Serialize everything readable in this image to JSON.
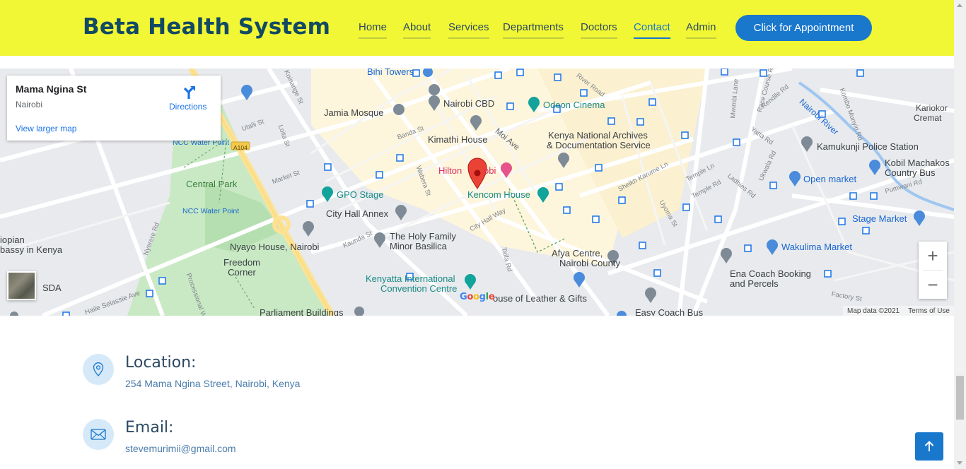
{
  "header": {
    "logo": "Beta Health System",
    "nav": [
      "Home",
      "About",
      "Services",
      "Departments",
      "Doctors",
      "Contact",
      "Admin"
    ],
    "active_nav": "Contact",
    "cta_label": "Click for Appointment"
  },
  "map": {
    "card": {
      "title": "Mama Ngina St",
      "subtitle": "Nairobi",
      "larger_map_link": "View larger map",
      "directions_label": "Directions"
    },
    "places": {
      "bihi_towers": "Bihi Towers",
      "nairobi_cbd": "Nairobi CBD",
      "odeon_cinema": "Odeon Cinema",
      "jamia_mosque": "Jamia Mosque",
      "kimathi_house": "Kimathi House",
      "kenya_archives_1": "Kenya National Archives",
      "kenya_archives_2": "& Documentation Service",
      "hilton_1": "Hilton",
      "hilton_2": "obi",
      "kencom_house": "Kencom House",
      "gpo_stage": "GPO Stage",
      "city_hall_annex": "City Hall Annex",
      "central_park": "Central Park",
      "ncc_water_point": "NCC Water Point",
      "holy_family_1": "The Holy Family",
      "holy_family_2": "Minor Basilica",
      "nyayo_house": "Nyayo House, Nairobi",
      "freedom_corner": "Freedom Corner",
      "kicc_1": "Kenyatta International",
      "kicc_2": "Convention Centre",
      "house_of_leather": "ouse of Leather & Gifts",
      "afya_centre_1": "Afya Centre,",
      "afya_centre_2": "Nairobi County",
      "ena_coach_1": "Ena Coach Booking",
      "ena_coach_2": "and Percels",
      "easy_coach": "Easy Coach Bus",
      "wakulima_market": "Wakulima Market",
      "stage_market": "Stage Market",
      "open_market": "Open market",
      "kamukunji_police": "Kamukunji Police Station",
      "kobil_1": "Kobil Machakos",
      "kobil_2": "Country Bus",
      "kariokor_1": "Kariokor",
      "kariokor_2": "Cremat",
      "nairobi_river": "Nairobi River",
      "parliament": "Parliament Buildings",
      "ethiopian_1": "iopian",
      "ethiopian_2": "bassy in Kenya",
      "sda": "SDA",
      "moi_ave": "Moi Ave",
      "a104": "A104",
      "processional_way": "Processional Way",
      "haile_selassie": "Haile Selassie Ave"
    },
    "streets": [
      "Utalii St",
      "Banda St",
      "Market St",
      "Wabera St",
      "Kaunda St",
      "City Hall Way",
      "Taifa Rd",
      "River Road",
      "Temple Ln",
      "Temple Rd",
      "Sheikh Karume Ln",
      "Uyoma St",
      "Ladhies Rd",
      "Ukwala Rd",
      "Yatta Rd",
      "Rendile Rd",
      "Nyerere Rd",
      "Koinange St",
      "Loita St",
      "Pumwani Rd",
      "Factory St",
      "Race Course Rd",
      "Mwimbi Lane",
      "Kombo Munyiri Rd"
    ],
    "google_logo": "Google",
    "map_data": "Map data ©2021",
    "terms": "Terms of Use",
    "zoom_in": "+",
    "zoom_out": "−"
  },
  "contact": {
    "location_heading": "Location:",
    "location_text": "254 Mama Ngina Street, Nairobi, Kenya",
    "email_heading": "Email:",
    "email_text": "stevemurimii@gmail.com"
  },
  "colors": {
    "header_bg": "#f1f734",
    "brand": "#124a63",
    "accent": "#1977cc",
    "nav_text": "#2c4964"
  },
  "icons": [
    "map-pin-icon",
    "envelope-icon",
    "arrow-up-icon",
    "directions-icon",
    "zoom-in-icon",
    "zoom-out-icon"
  ]
}
